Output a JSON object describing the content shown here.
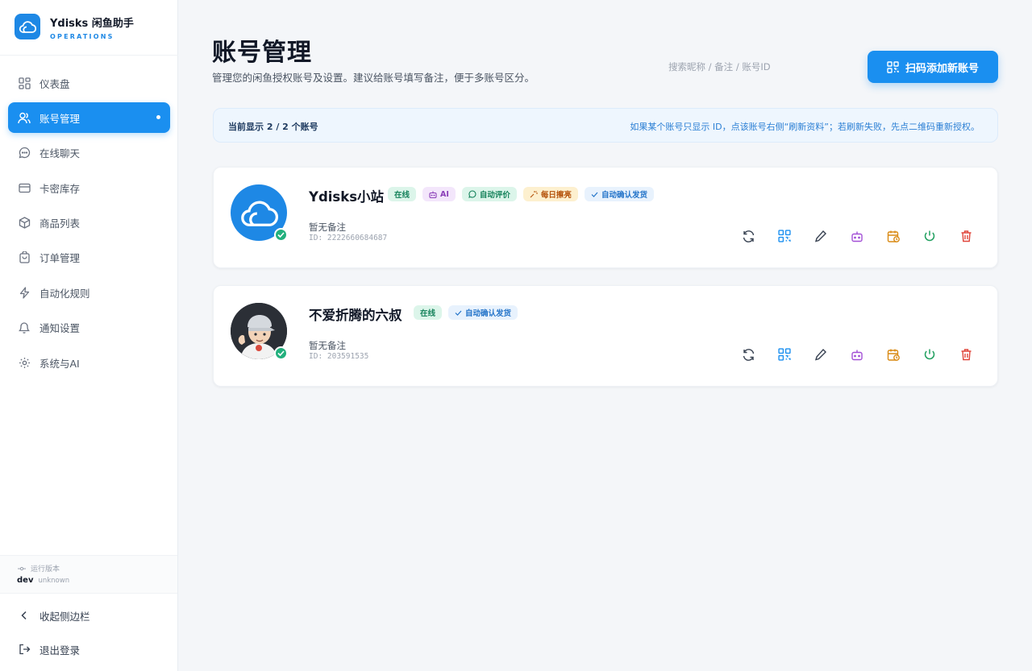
{
  "brand": {
    "name": "Ydisks 闲鱼助手",
    "subtitle": "OPERATIONS",
    "accent": "#1a8ff0"
  },
  "sidebar": {
    "items": [
      {
        "label": "仪表盘",
        "icon": "dashboard-icon",
        "active": false
      },
      {
        "label": "账号管理",
        "icon": "users-icon",
        "active": true
      },
      {
        "label": "在线聊天",
        "icon": "chat-icon",
        "active": false
      },
      {
        "label": "卡密库存",
        "icon": "card-icon",
        "active": false
      },
      {
        "label": "商品列表",
        "icon": "box-icon",
        "active": false
      },
      {
        "label": "订单管理",
        "icon": "bag-icon",
        "active": false
      },
      {
        "label": "自动化规则",
        "icon": "bolt-icon",
        "active": false
      },
      {
        "label": "通知设置",
        "icon": "bell-icon",
        "active": false
      },
      {
        "label": "系统与AI",
        "icon": "gear-icon",
        "active": false
      }
    ],
    "version_label": "运行版本",
    "version_value": "dev",
    "version_build": "unknown",
    "collapse_label": "收起侧边栏",
    "logout_label": "退出登录"
  },
  "header": {
    "title": "账号管理",
    "subtitle": "管理您的闲鱼授权账号及设置。建议给账号填写备注，便于多账号区分。",
    "search_placeholder": "搜索昵称 / 备注 / 账号ID",
    "add_button": "扫码添加新账号"
  },
  "info_bar": {
    "count_text": "当前显示 2 / 2 个账号",
    "hint": "如果某个账号只显示 ID，点该账号右侧“刷新资料”；若刷新失败，先点二维码重新授权。"
  },
  "accounts": [
    {
      "name": "Ydisks小站",
      "badges": [
        "在线",
        "AI",
        "自动评价",
        "每日擦亮",
        "自动确认发货"
      ],
      "note": "暂无备注",
      "id": "ID: 2222660684687"
    },
    {
      "name": "不爱折腾的六叔",
      "badges": [
        "在线",
        "自动确认发货"
      ],
      "note": "暂无备注",
      "id": "ID: 203591535"
    }
  ],
  "action_icons": [
    "refresh-icon",
    "qrcode-icon",
    "edit-icon",
    "robot-icon",
    "schedule-icon",
    "power-icon",
    "trash-icon"
  ],
  "colors": {
    "online": "#15825b",
    "ai": "#8b3fb8",
    "polish": "#b4520b",
    "ship": "#2474c9",
    "danger": "#e0453a"
  }
}
